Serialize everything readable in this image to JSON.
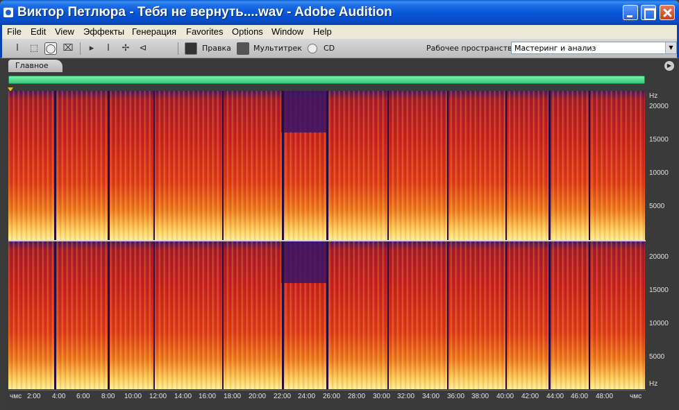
{
  "window": {
    "title": "Виктор Петлюра - Тебя не вернуть....wav - Adobe Audition"
  },
  "menu": [
    "File",
    "Edit",
    "View",
    "Эффекты",
    "Генерация",
    "Favorites",
    "Options",
    "Window",
    "Help"
  ],
  "toolbar": {
    "tools": [
      "time-selection-icon",
      "marquee-selection-icon",
      "lasso-selection-icon",
      "effects-brush-icon",
      "move-icon",
      "cursor-icon",
      "spot-healing-icon",
      "scrub-icon"
    ],
    "modes": [
      {
        "label": "Правка",
        "icon": "waveform-edit-icon"
      },
      {
        "label": "Мультитрек",
        "icon": "multitrack-icon"
      },
      {
        "label": "CD",
        "icon": "cd-icon"
      }
    ],
    "workspace_label": "Рабочее пространство:",
    "workspace_value": "Мастеринг и анализ"
  },
  "panel": {
    "tab_label": "Главное"
  },
  "hz_scale": {
    "unit": "Hz",
    "labels": [
      "20000",
      "15000",
      "10000",
      "5000"
    ]
  },
  "time_ruler": {
    "start_label": "чмс",
    "end_label": "чмс",
    "labels": [
      "2:00",
      "4:00",
      "6:00",
      "8:00",
      "10:00",
      "12:00",
      "14:00",
      "16:00",
      "18:00",
      "20:00",
      "22:00",
      "24:00",
      "26:00",
      "28:00",
      "30:00",
      "32:00",
      "34:00",
      "36:00",
      "38:00",
      "40:00",
      "42:00",
      "44:00",
      "46:00",
      "48:00"
    ]
  },
  "colors": {
    "titlebar": "#0a54d6",
    "overview": "#32c97a",
    "spectral_high": "#fff4a0",
    "spectral_mid": "#d82a1c",
    "spectral_low": "#4a1560"
  }
}
